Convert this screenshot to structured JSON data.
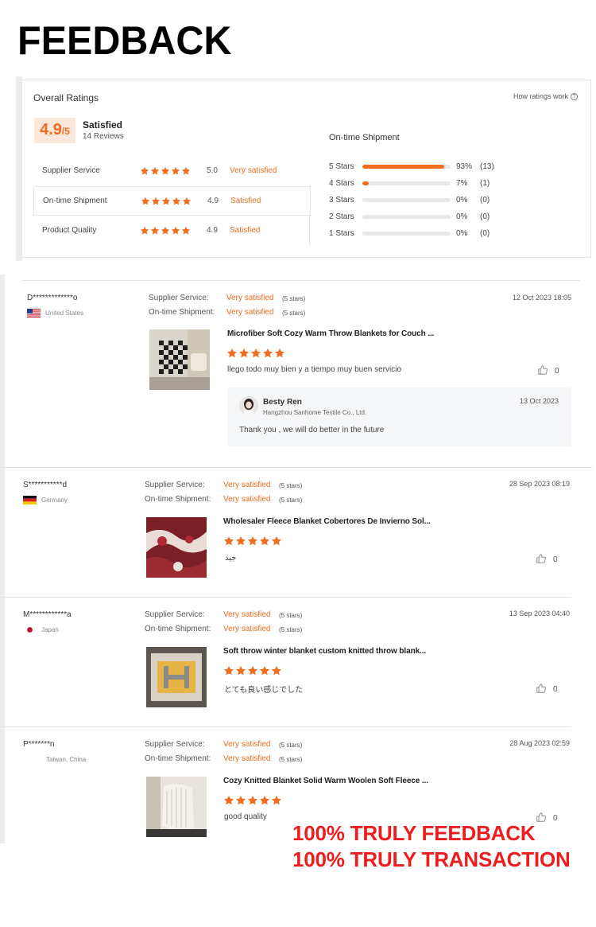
{
  "page_title": "FEEDBACK",
  "overall": {
    "title": "Overall Ratings",
    "how_link": "How ratings work",
    "score": "4.9",
    "score_suffix": "/5",
    "label": "Satisfied",
    "reviews": "14 Reviews",
    "metrics": [
      {
        "name": "Supplier Service",
        "score": "5.0",
        "text": "Very satisfied"
      },
      {
        "name": "On-time Shipment",
        "score": "4.9",
        "text": "Satisfied"
      },
      {
        "name": "Product Quality",
        "score": "4.9",
        "text": "Satisfied"
      }
    ]
  },
  "shipment": {
    "title": "On-time Shipment",
    "rows": [
      {
        "label": "5  Stars",
        "fraction": 0.93,
        "pct": "93%",
        "count": "(13)"
      },
      {
        "label": "4  Stars",
        "fraction": 0.07,
        "pct": "7%",
        "count": "(1)"
      },
      {
        "label": "3  Stars",
        "fraction": 0,
        "pct": "0%",
        "count": "(0)"
      },
      {
        "label": "2  Stars",
        "fraction": 0,
        "pct": "0%",
        "count": "(0)"
      },
      {
        "label": "1  Stars",
        "fraction": 0,
        "pct": "0%",
        "count": "(0)"
      }
    ]
  },
  "labels": {
    "supplier_service": "Supplier Service:",
    "ontime_shipment": "On-time Shipment:",
    "very_satisfied": "Very satisfied",
    "five_stars": "(5 stars)"
  },
  "reviews": [
    {
      "name": "D*************o",
      "country": "United States",
      "date": "12 Oct 2023 18:05",
      "product": "Microfiber Soft Cozy Warm Throw Blankets for Couch ...",
      "text": "llego todo muy bien y a tiempo muy buen servicio",
      "likes": "0"
    },
    {
      "name": "S***********d",
      "country": "Germany",
      "date": "28 Sep 2023 08:19",
      "product": "Wholesaler Fleece Blanket Cobertores De Invierno Sol...",
      "text": "جيد",
      "likes": "0"
    },
    {
      "name": "M************a",
      "country": "Japan",
      "date": "13 Sep 2023 04:40",
      "product": "Soft throw winter blanket custom knitted throw blank...",
      "text": "とても良い感じでした",
      "likes": "0"
    },
    {
      "name": "P*******n",
      "country": "Taiwan, China",
      "date": "28 Aug 2023 02:59",
      "product": "Cozy Knitted Blanket Solid Warm Woolen Soft Fleece ...",
      "text": "good quality",
      "likes": "0"
    }
  ],
  "reply": {
    "name": "Besty Ren",
    "company": "Hangzhou Sanhome Textile Co., Ltd.",
    "date": "13 Oct 2023",
    "text": "Thank you , we will do better in the future"
  },
  "promo": {
    "line1": "100% TRULY FEEDBACK",
    "line2": "100% TRULY TRANSACTION"
  },
  "colors": {
    "accent": "#f06d1e",
    "promo": "#ee1c1c"
  }
}
